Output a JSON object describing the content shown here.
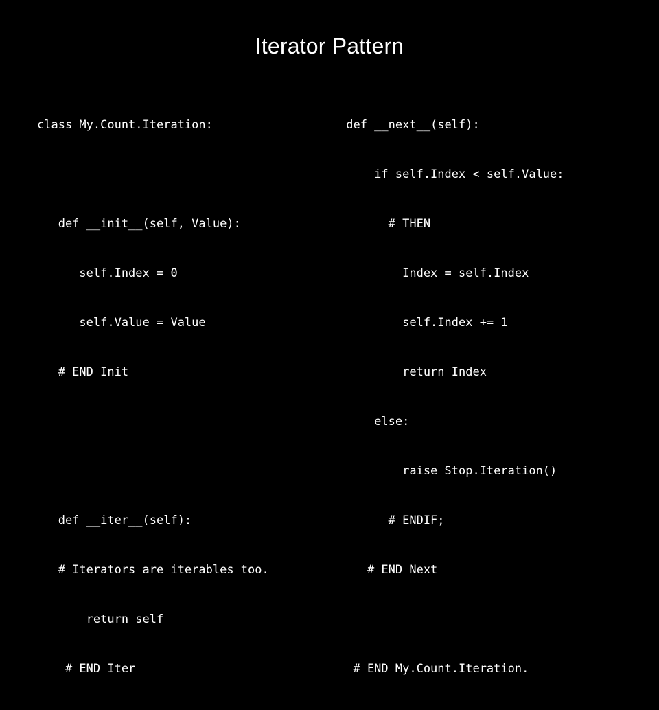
{
  "slide": {
    "title": "Iterator Pattern",
    "background_color": "#000000",
    "text_color": "#ffffff",
    "left_code": [
      "class My.Count.Iteration:",
      "",
      "   def __init__(self, Value):",
      "      self.Index = 0",
      "      self.Value = Value",
      "   # END Init",
      "",
      "",
      "   def __iter__(self):",
      "   # Iterators are iterables too.",
      "       return self",
      "    # END Iter"
    ],
    "right_code": [
      " def __next__(self):",
      "     if self.Index < self.Value:",
      "       # THEN",
      "         Index = self.Index",
      "         self.Index += 1",
      "         return Index",
      "     else:",
      "         raise Stop.Iteration()",
      "       # ENDIF;",
      "    # END Next",
      "",
      "  # END My.Count.Iteration."
    ]
  }
}
